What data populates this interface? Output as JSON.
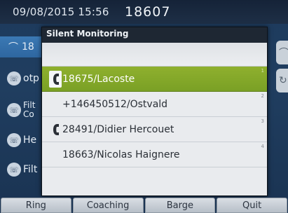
{
  "status_bar": {
    "datetime": "09/08/2015 15:56",
    "extension": "18607"
  },
  "background_lines": [
    {
      "label": "18",
      "icon": "phone-line-icon"
    },
    {
      "label": "otp",
      "icon": "speed-dial-icon"
    },
    {
      "label": "Filt Co",
      "icon": "speed-dial-icon"
    },
    {
      "label": "He",
      "icon": "speed-dial-icon"
    },
    {
      "label": "Filt",
      "icon": "speed-dial-icon"
    }
  ],
  "popup": {
    "title": "Silent Monitoring",
    "rows": [
      {
        "index": "1",
        "label": "18675/Lacoste",
        "icon": "handset-icon",
        "selected": true
      },
      {
        "index": "2",
        "label": "+146450512/Ostvald",
        "icon": "",
        "selected": false
      },
      {
        "index": "3",
        "label": "28491/Didier Hercouet",
        "icon": "handset-icon",
        "selected": false
      },
      {
        "index": "4",
        "label": "18663/Nicolas Haignere",
        "icon": "",
        "selected": false
      }
    ]
  },
  "softkeys": {
    "ring": "Ring",
    "coaching": "Coaching",
    "barge": "Barge",
    "quit": "Quit"
  },
  "colors": {
    "selected_row": "#8fb02e",
    "popup_title_bar": "#1e2733",
    "background": "#1d3a5c"
  }
}
